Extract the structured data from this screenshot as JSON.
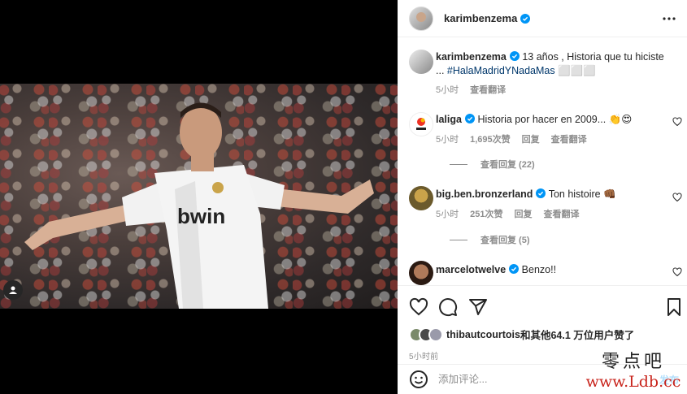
{
  "post": {
    "author": "karimbenzema",
    "more_label": "⋯"
  },
  "caption": {
    "username": "karimbenzema",
    "text": "13 años , Historia que tu hiciste ... ",
    "hashtag": "#HalaMadridYNadaMas",
    "emoji": "⬜⬜⬜",
    "time": "5小时",
    "translate": "查看翻译"
  },
  "comments": [
    {
      "username": "laliga",
      "text": "Historia por hacer en 2009... ",
      "emoji": "👏😍",
      "time": "5小时",
      "likes": "1,695次赞",
      "reply": "回复",
      "translate": "查看翻译",
      "replies": "查看回复 (22)"
    },
    {
      "username": "big.ben.bronzerland",
      "text": "Ton histoire ",
      "emoji": "👊🏾",
      "time": "5小时",
      "likes": "251次赞",
      "reply": "回复",
      "translate": "查看翻译",
      "replies": "查看回复 (5)"
    },
    {
      "username": "marcelotwelve",
      "text": "Benzo!!"
    }
  ],
  "likes": {
    "user": "thibautcourtois",
    "rest": "和其他64.1 万位用户赞了"
  },
  "post_time": "5小时前",
  "add_comment": {
    "placeholder": "添加评论...",
    "post_label": "发布"
  },
  "watermark": {
    "top": "零点吧",
    "bottom": "www.Ldb.cc"
  },
  "colors": {
    "verified": "#0095f6",
    "hashtag": "#00376b",
    "muted": "#8e8e8e"
  },
  "icons": [
    "verified-icon",
    "more-icon",
    "heart-icon",
    "comment-icon",
    "share-icon",
    "bookmark-icon",
    "emoji-icon",
    "user-tag-icon"
  ]
}
